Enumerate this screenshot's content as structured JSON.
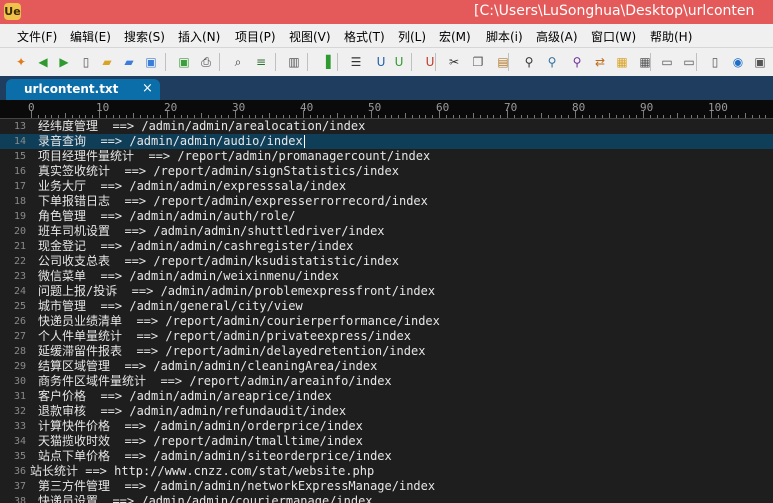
{
  "window": {
    "app_icon_label": "Ue",
    "title": "[C:\\Users\\LuSonghua\\Desktop\\urlconten"
  },
  "menu": [
    "文件(F)",
    "编辑(E)",
    "搜索(S)",
    "插入(N)",
    "项目(P)",
    "视图(V)",
    "格式(T)",
    "列(L)",
    "宏(M)",
    "脚本(i)",
    "高级(A)",
    "窗口(W)",
    "帮助(H)"
  ],
  "toolbar": {
    "buttons": [
      {
        "name": "new-wizard-icon",
        "glyph": "✦",
        "color": "#e07b1a"
      },
      {
        "name": "back-icon",
        "glyph": "◀",
        "color": "#2f9a2f"
      },
      {
        "name": "forward-icon",
        "glyph": "▶",
        "color": "#2f9a2f"
      },
      {
        "name": "new-file-icon",
        "glyph": "▯",
        "color": "#555555"
      },
      {
        "name": "open-folder-icon",
        "glyph": "▰",
        "color": "#d9a325"
      },
      {
        "name": "open-recent-icon",
        "glyph": "▰",
        "color": "#3b7dd8"
      },
      {
        "name": "save-icon",
        "glyph": "▣",
        "color": "#3b7dd8"
      },
      {
        "name": "save-all-icon",
        "glyph": "▣",
        "color": "#3ba03b"
      },
      {
        "name": "print-icon",
        "glyph": "⎙",
        "color": "#333333"
      },
      {
        "name": "print-preview-icon",
        "glyph": "⌕",
        "color": "#333333"
      },
      {
        "name": "word-wrap-icon",
        "glyph": "≡",
        "color": "#2f6f2f"
      },
      {
        "name": "hex-edit-icon",
        "glyph": "▥",
        "color": "#555555"
      },
      {
        "name": "column-mode-icon",
        "glyph": "▐",
        "color": "#2f9a2f"
      },
      {
        "name": "list-lines-icon",
        "glyph": "☰",
        "color": "#333333"
      },
      {
        "name": "u-dos-icon",
        "glyph": "U",
        "color": "#1f5fa8"
      },
      {
        "name": "u-unix-icon",
        "glyph": "U",
        "color": "#2f9a2f"
      },
      {
        "name": "u-mac-icon",
        "glyph": "U",
        "color": "#c0392b"
      },
      {
        "name": "cut-icon",
        "glyph": "✂",
        "color": "#333333"
      },
      {
        "name": "copy-icon",
        "glyph": "❐",
        "color": "#555555"
      },
      {
        "name": "paste-icon",
        "glyph": "▤",
        "color": "#b07a2a"
      },
      {
        "name": "find-icon",
        "glyph": "⚲",
        "color": "#333333"
      },
      {
        "name": "find-next-icon",
        "glyph": "⚲",
        "color": "#2f6f9a"
      },
      {
        "name": "find-prev-icon",
        "glyph": "⚲",
        "color": "#6f2f9a"
      },
      {
        "name": "replace-icon",
        "glyph": "⇄",
        "color": "#c06a1a"
      },
      {
        "name": "find-in-files-icon",
        "glyph": "▦",
        "color": "#d9a325"
      },
      {
        "name": "replace-in-files-icon",
        "glyph": "▦",
        "color": "#555555"
      },
      {
        "name": "window-list-icon",
        "glyph": "▭",
        "color": "#555555"
      },
      {
        "name": "tile-horizontal-icon",
        "glyph": "▭",
        "color": "#555555"
      },
      {
        "name": "tile-vertical-icon",
        "glyph": "▯",
        "color": "#555555"
      },
      {
        "name": "browser-icon",
        "glyph": "◉",
        "color": "#1f6fc8"
      },
      {
        "name": "screenshot-icon",
        "glyph": "▣",
        "color": "#555555"
      },
      {
        "name": "ftp-icon",
        "glyph": "⊞",
        "color": "#555555"
      }
    ]
  },
  "tab": {
    "label": "urlcontent.txt",
    "close_glyph": "×"
  },
  "ruler": {
    "labels": [
      "0",
      "10",
      "20",
      "30",
      "40",
      "50",
      "60",
      "70",
      "80",
      "90",
      "100"
    ]
  },
  "editor": {
    "current_line": 14,
    "lines": [
      {
        "n": "13",
        "text": "经纬度管理  ==> /admin/admin/arealocation/index"
      },
      {
        "n": "14",
        "text": "录音查询  ==> /admin/admin/audio/index"
      },
      {
        "n": "15",
        "text": "项目经理件量统计  ==> /report/admin/promanagercount/index"
      },
      {
        "n": "16",
        "text": "真实签收统计  ==> /report/admin/signStatistics/index"
      },
      {
        "n": "17",
        "text": "业务大厅  ==> /admin/admin/expresssala/index"
      },
      {
        "n": "18",
        "text": "下单报错日志  ==> /report/admin/expresserrorrecord/index"
      },
      {
        "n": "19",
        "text": "角色管理  ==> /admin/admin/auth/role/"
      },
      {
        "n": "20",
        "text": "班车司机设置  ==> /admin/admin/shuttledriver/index"
      },
      {
        "n": "21",
        "text": "现金登记  ==> /admin/admin/cashregister/index"
      },
      {
        "n": "22",
        "text": "公司收支总表  ==> /report/admin/ksudistatistic/index"
      },
      {
        "n": "23",
        "text": "微信菜单  ==> /admin/admin/weixinmenu/index"
      },
      {
        "n": "24",
        "text": "问题上报/投诉  ==> /admin/admin/problemexpressfront/index"
      },
      {
        "n": "25",
        "text": "城市管理  ==> /admin/general/city/view"
      },
      {
        "n": "26",
        "text": "快递员业绩清单  ==> /report/admin/courierperformance/index"
      },
      {
        "n": "27",
        "text": "个人件单量统计  ==> /report/admin/privateexpress/index"
      },
      {
        "n": "28",
        "text": "延缓滞留件报表  ==> /report/admin/delayedretention/index"
      },
      {
        "n": "29",
        "text": "结算区域管理  ==> /admin/admin/cleaningArea/index"
      },
      {
        "n": "30",
        "text": "商务件区域件量统计  ==> /report/admin/areainfo/index"
      },
      {
        "n": "31",
        "text": "客户价格  ==> /admin/admin/areaprice/index"
      },
      {
        "n": "32",
        "text": "退款审核  ==> /admin/admin/refundaudit/index"
      },
      {
        "n": "33",
        "text": "计算快件价格  ==> /admin/admin/orderprice/index"
      },
      {
        "n": "34",
        "text": "天猫揽收时效  ==> /report/admin/tmalltime/index"
      },
      {
        "n": "35",
        "text": "站点下单价格  ==> /admin/admin/siteorderprice/index"
      },
      {
        "n": "36",
        "text": "站长统计 ==> http://www.cnzz.com/stat/website.php",
        "noindent": true
      },
      {
        "n": "37",
        "text": "第三方件管理  ==> /admin/admin/networkExpressManage/index"
      },
      {
        "n": "38",
        "text": "快递员设置  ==> /admin/admin/couriermanage/index"
      }
    ]
  }
}
